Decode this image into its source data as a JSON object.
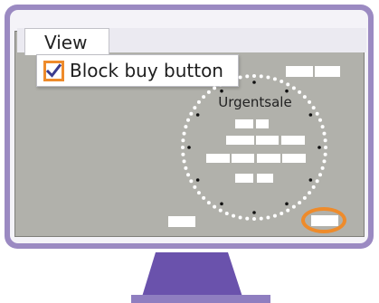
{
  "menu": {
    "view_label": "View"
  },
  "dropdown": {
    "item_label": "Block buy button",
    "checked": true
  },
  "sale_panel": {
    "label": "Urgentsale"
  },
  "colors": {
    "monitor_frame": "#9b8ac2",
    "screen_background": "#b1b1ab",
    "highlight": "#ee8b2b",
    "stand": "#6a52ac"
  }
}
